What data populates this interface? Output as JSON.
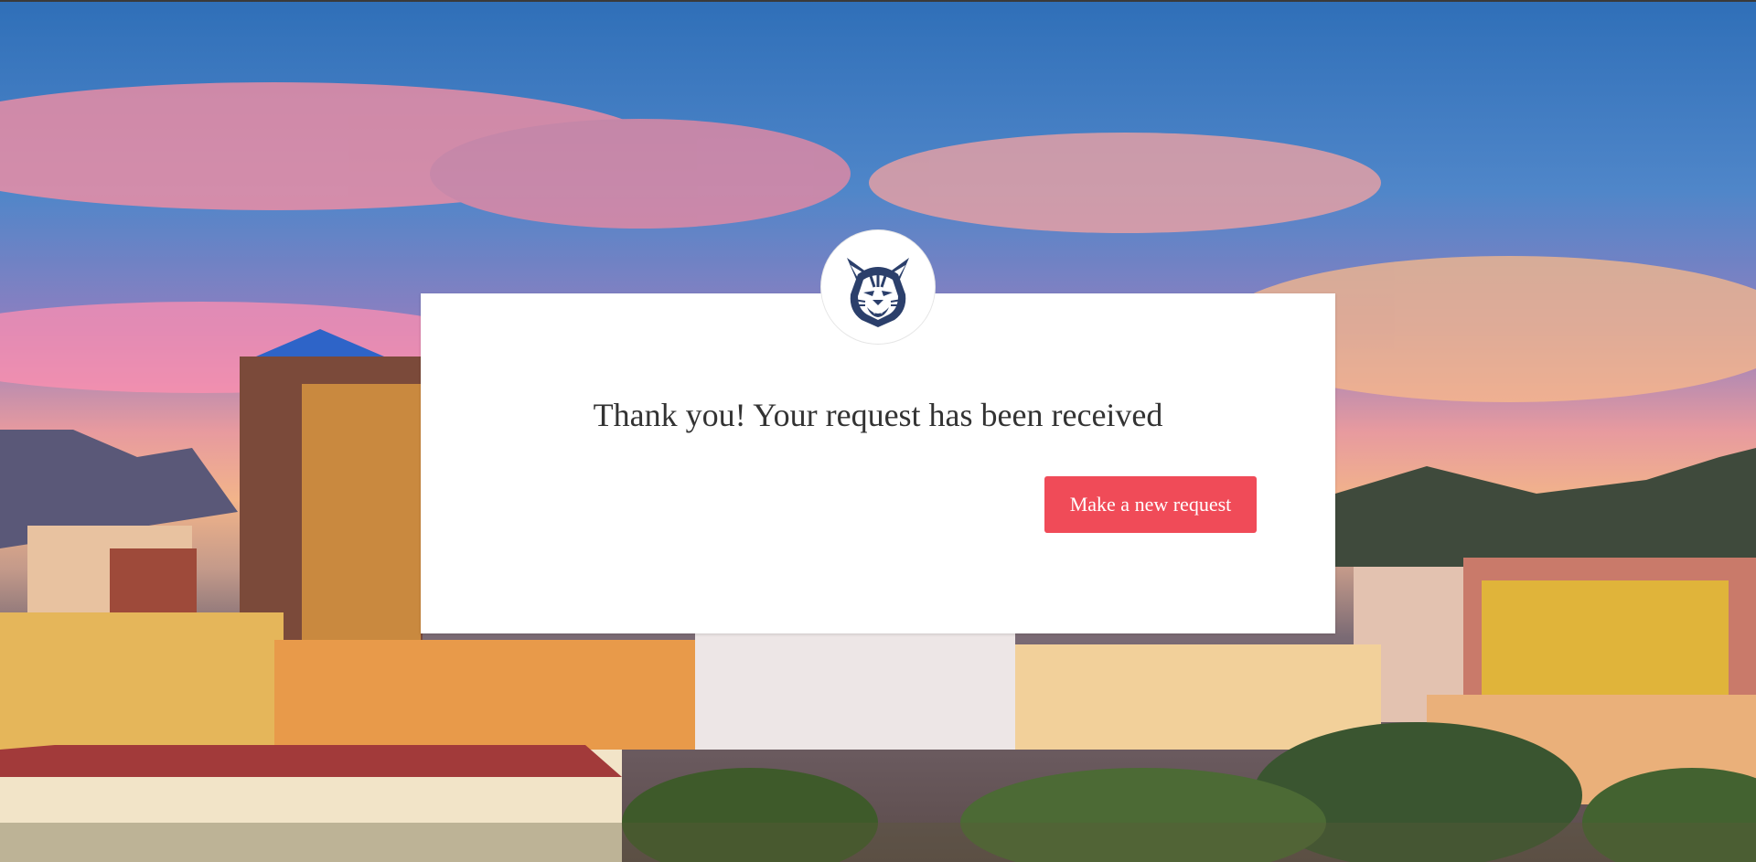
{
  "page": {
    "title": "Thank you! Your request has been received"
  },
  "actions": {
    "new_request_label": "Make a new request"
  },
  "logo": {
    "icon": "wildcat-mascot-icon"
  },
  "background": {
    "scene": "city-skyline-sunset"
  },
  "colors": {
    "button": "#f04b58",
    "button_text": "#ffffff",
    "card": "#ffffff",
    "title_text": "#333333",
    "mascot": "#2b3f6b"
  }
}
